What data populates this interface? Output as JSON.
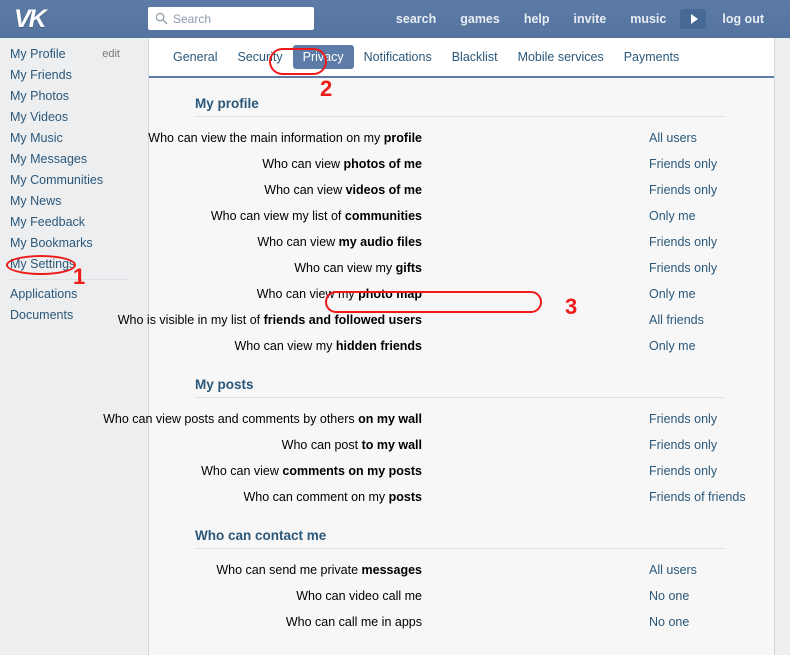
{
  "header": {
    "logo": "VK",
    "logo_icon": "vk-logo-icon",
    "search": {
      "icon": "search-icon",
      "placeholder": "Search",
      "value": ""
    },
    "nav": [
      {
        "label": "search"
      },
      {
        "label": "games"
      },
      {
        "label": "help"
      },
      {
        "label": "invite"
      },
      {
        "label": "music"
      }
    ],
    "music_play_icon": "play-icon",
    "logout_label": "log out",
    "background_color": "#55769f"
  },
  "sidebar": {
    "items": [
      {
        "label": "My Profile",
        "extra": "edit"
      },
      {
        "label": "My Friends"
      },
      {
        "label": "My Photos"
      },
      {
        "label": "My Videos"
      },
      {
        "label": "My Music"
      },
      {
        "label": "My Messages"
      },
      {
        "label": "My Communities"
      },
      {
        "label": "My News"
      },
      {
        "label": "My Feedback"
      },
      {
        "label": "My Bookmarks"
      },
      {
        "label": "My Settings"
      }
    ],
    "items_after_divider": [
      {
        "label": "Applications"
      },
      {
        "label": "Documents"
      }
    ]
  },
  "tabs": [
    {
      "label": "General",
      "active": false
    },
    {
      "label": "Security",
      "active": false
    },
    {
      "label": "Privacy",
      "active": true
    },
    {
      "label": "Notifications",
      "active": false
    },
    {
      "label": "Blacklist",
      "active": false
    },
    {
      "label": "Mobile services",
      "active": false
    },
    {
      "label": "Payments",
      "active": false
    }
  ],
  "sections": [
    {
      "title": "My profile",
      "rows": [
        {
          "label_plain": "Who can view the main information on my ",
          "label_bold": "profile",
          "value": "All users"
        },
        {
          "label_plain": "Who can view ",
          "label_bold": "photos of me",
          "value": "Friends only"
        },
        {
          "label_plain": "Who can view ",
          "label_bold": "videos of me",
          "value": "Friends only"
        },
        {
          "label_plain": "Who can view my list of ",
          "label_bold": "communities",
          "value": "Only me"
        },
        {
          "label_plain": "Who can view ",
          "label_bold": "my audio files",
          "value": "Friends only"
        },
        {
          "label_plain": "Who can view my ",
          "label_bold": "gifts",
          "value": "Friends only"
        },
        {
          "label_plain": "Who can view my ",
          "label_bold": "photo map",
          "value": "Only me"
        },
        {
          "label_plain": "Who is visible in my list of ",
          "label_bold": "friends and followed users",
          "value": "All friends"
        },
        {
          "label_plain": "Who can view my ",
          "label_bold": "hidden friends",
          "value": "Only me"
        }
      ]
    },
    {
      "title": "My posts",
      "rows": [
        {
          "label_plain": "Who can view posts and comments by others ",
          "label_bold": "on my wall",
          "value": "Friends only"
        },
        {
          "label_plain": "Who can post ",
          "label_bold": "to my wall",
          "value": "Friends only"
        },
        {
          "label_plain": "Who can view ",
          "label_bold": "comments on my posts",
          "value": "Friends only"
        },
        {
          "label_plain": "Who can comment on my ",
          "label_bold": "posts",
          "value": "Friends of friends"
        }
      ]
    },
    {
      "title": "Who can contact me",
      "rows": [
        {
          "label_plain": "Who can send me private ",
          "label_bold": "messages",
          "value": "All users"
        },
        {
          "label_plain": "Who can video call me",
          "label_bold": "",
          "value": "No one"
        },
        {
          "label_plain": "Who can call me in apps",
          "label_bold": "",
          "value": "No one"
        }
      ]
    }
  ],
  "annotations": [
    {
      "number": "1",
      "target": "My Settings"
    },
    {
      "number": "2",
      "target": "Privacy"
    },
    {
      "number": "3",
      "target": "Who can view my photo map"
    }
  ],
  "colors": {
    "header": "#55769f",
    "link": "#2b587a",
    "annotation": "#ee1b1b",
    "active_tab": "#5c7ba6"
  }
}
